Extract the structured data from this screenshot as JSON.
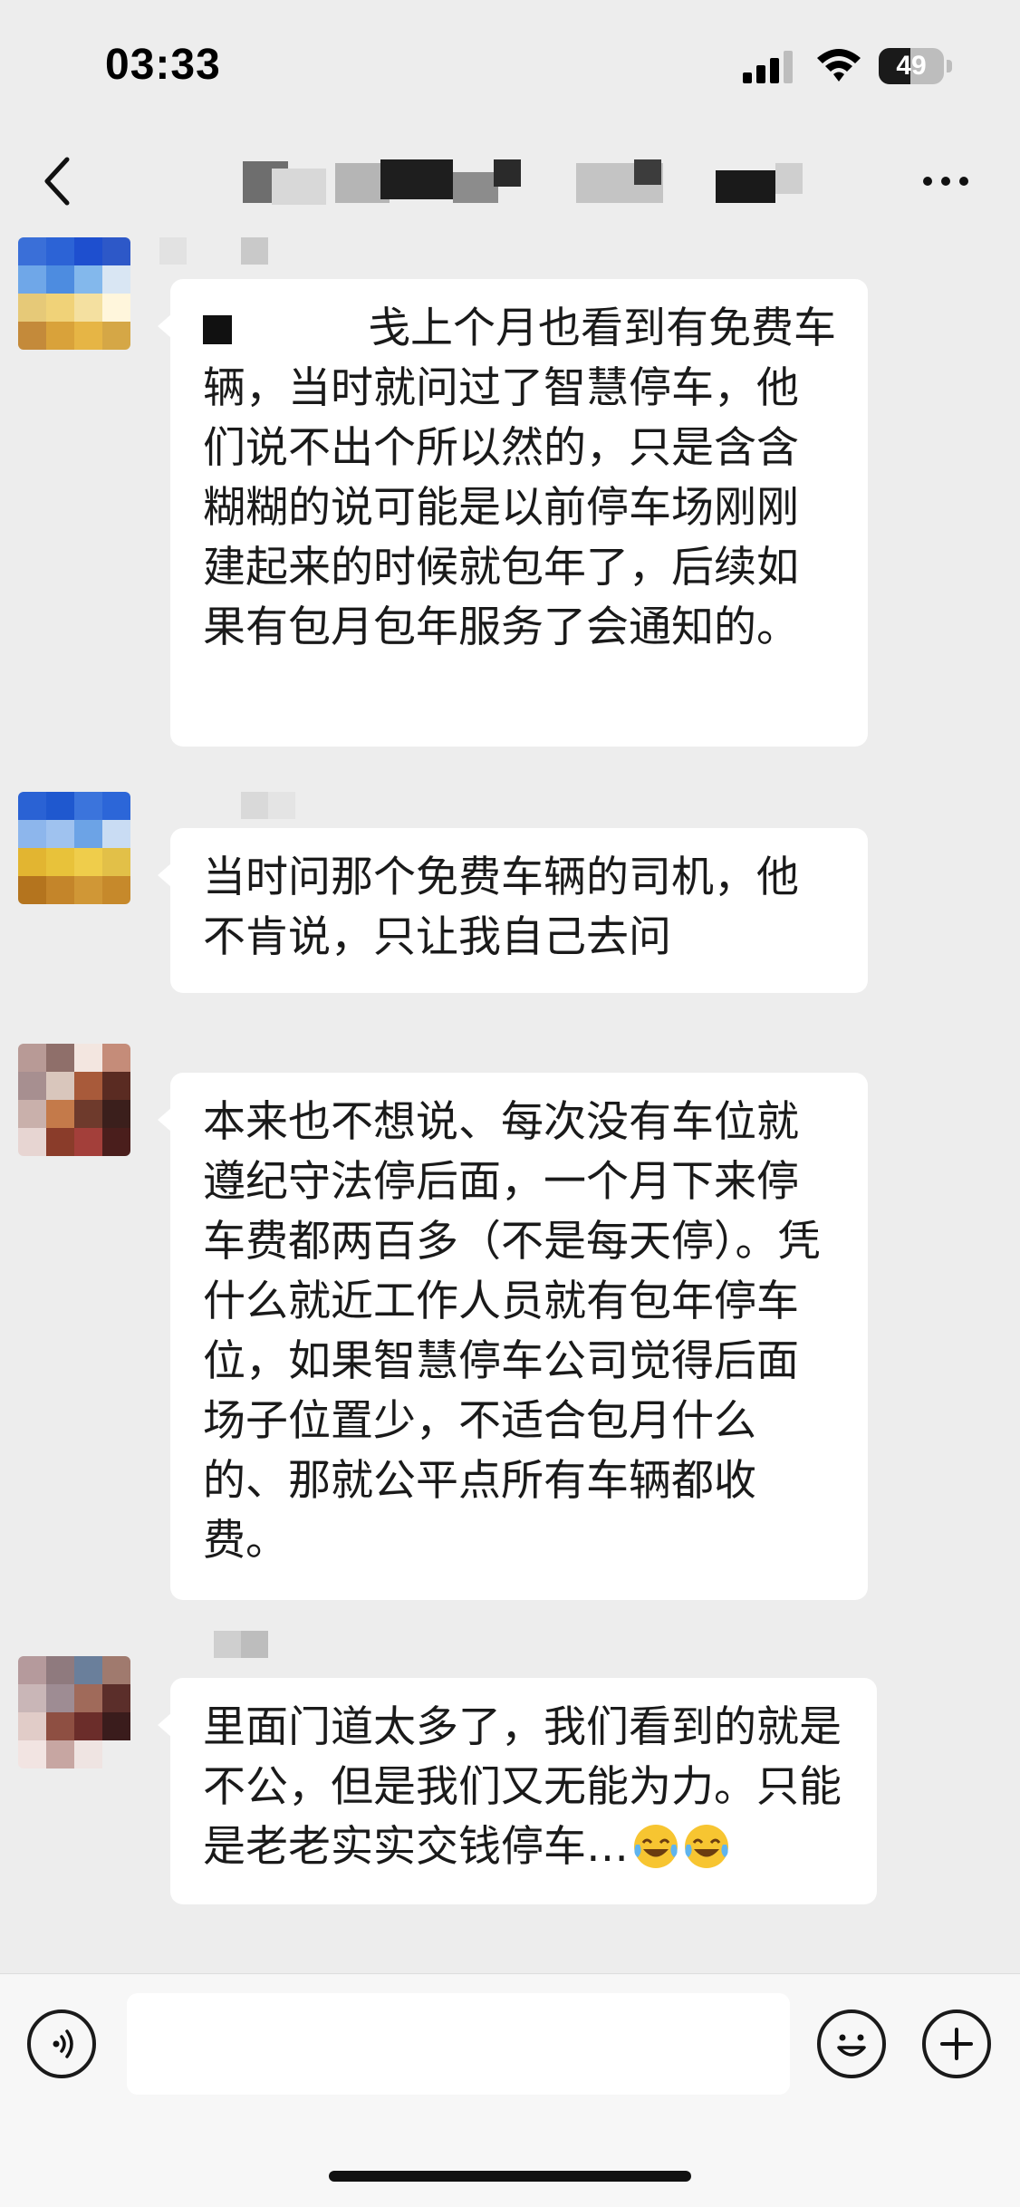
{
  "status_bar": {
    "time": "03:33",
    "battery_level": "49",
    "battery_fraction": 0.49,
    "signal_bars": 3
  },
  "nav": {
    "back_icon": "chevron-left-icon",
    "more_icon": "ellipsis-icon",
    "title_is_redacted": true
  },
  "messages": [
    {
      "text": "我上个月也看到有免费车辆，当时就问过了智慧停车，他们说不出个所以然的，只是含含糊糊的说可能是以前停车场刚刚建起来的时候就包年了，后续如果有包月包年服务了会通知的。",
      "text_visible": "戋上个月也看到有免费车辆，当时就问过了智慧停车，他们说不出个所以然的，只是含含糊糊的说可能是以前停车场刚刚建起来的时候就包年了，后续如果有包月包年服务了会通知的。",
      "avatar_colors": [
        "#3a6fd8",
        "#2c63d6",
        "#1e4fcf",
        "#2d58c8",
        "#6fa7e8",
        "#4d8ce0",
        "#83b8ec",
        "#d9e6f3",
        "#e6c978",
        "#f0d278",
        "#f4e0a0",
        "#fff6dc",
        "#c48a3a",
        "#d9a23a",
        "#e6b545",
        "#d5a746"
      ]
    },
    {
      "text": "当时问那个免费车辆的司机，他不肯说，只让我自己去问",
      "avatar_colors": [
        "#2a62d4",
        "#1f58cf",
        "#3b74dc",
        "#2c66d8",
        "#8db6ec",
        "#9fc2ef",
        "#6ca3e6",
        "#c9dcf3",
        "#e2b531",
        "#e8c23a",
        "#efcd4b",
        "#e2c048",
        "#b4741e",
        "#c4852a",
        "#d09736",
        "#c6892b"
      ]
    },
    {
      "text": "本来也不想说、每次没有车位就遵纪守法停后面，一个月下来停车费都两百多（不是每天停）。凭什么就近工作人员就有包年停车位，如果智慧停车公司觉得后面场子位置少，不适合包月什么的、那就公平点所有车辆都收费。",
      "avatar_colors": [
        "#b89a96",
        "#8f6f6a",
        "#f3e6e0",
        "#c58c79",
        "#a78f90",
        "#d9c6bc",
        "#a85a3a",
        "#5a2b22",
        "#c9b0ab",
        "#c47a4a",
        "#6e3a2c",
        "#3b1f1c",
        "#e7d5d2",
        "#8a3c2a",
        "#a33f3a",
        "#4a1e1c"
      ]
    },
    {
      "text": "里面门道太多了，我们看到的就是不公，但是我们又无能为力。只能是老老实实交钱停车…",
      "emoji": [
        "😂",
        "😂"
      ],
      "avatar_colors": [
        "#b59a9c",
        "#8f7a7e",
        "#6a7f9b",
        "#a07a6e",
        "#c9b6b7",
        "#9e8c93",
        "#a06a5a",
        "#5b2e2a",
        "#e1ccc8",
        "#8e4f42",
        "#6b2d2a",
        "#3a1c1c",
        "#f2e4e2",
        "#c7a6a2",
        "#efe4e2",
        "#ededed"
      ]
    }
  ],
  "input_bar": {
    "voice_icon": "voice-icon",
    "emoji_icon": "emoji-icon",
    "plus_icon": "plus-icon",
    "input_value": ""
  }
}
